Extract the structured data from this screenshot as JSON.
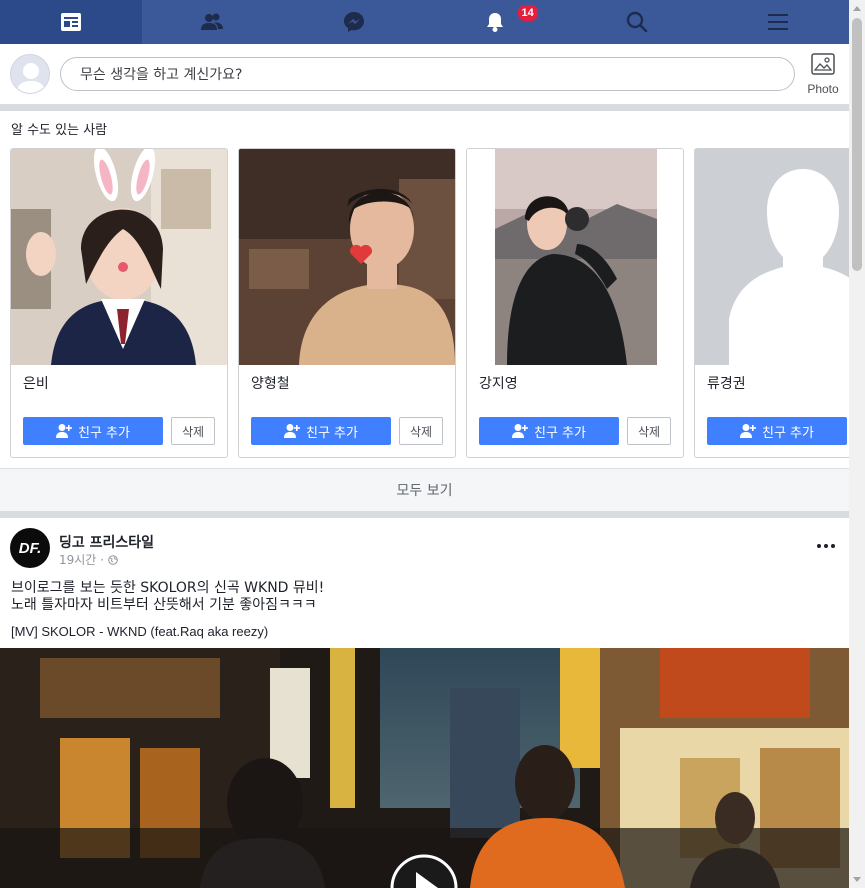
{
  "nav": {
    "tabs": [
      {
        "icon": "news-feed-icon",
        "active": true
      },
      {
        "icon": "friends-icon"
      },
      {
        "icon": "messenger-icon"
      },
      {
        "icon": "notifications-bell-icon",
        "badge": "14"
      },
      {
        "icon": "search-icon"
      },
      {
        "icon": "menu-icon"
      }
    ],
    "color": "#3b5998"
  },
  "composer": {
    "placeholder": "무슨 생각을 하고 계신가요?",
    "photo_label": "Photo"
  },
  "pymk": {
    "title": "알 수도 있는 사람",
    "add_label": "친구 추가",
    "delete_label": "삭제",
    "people": [
      {
        "name": "은비"
      },
      {
        "name": "양형철"
      },
      {
        "name": "강지영"
      },
      {
        "name": "류경권"
      }
    ],
    "see_all": "모두 보기"
  },
  "post": {
    "author": "딩고 프리스타일",
    "time": "19시간 ·",
    "logo_text": "DF.",
    "text_line1": "브이로그를 보는 듯한 SKOLOR의 신곡 WKND 뮤비!",
    "text_line2": "노래 틀자마자 비트부터 산뜻해서 기분 좋아짐ㅋㅋㅋ",
    "link_title": "[MV] SKOLOR - WKND (feat.Raq aka reezy)"
  },
  "colors": {
    "accent": "#4080ff",
    "nav_bg": "#3b5998",
    "badge": "#e41e3f"
  }
}
